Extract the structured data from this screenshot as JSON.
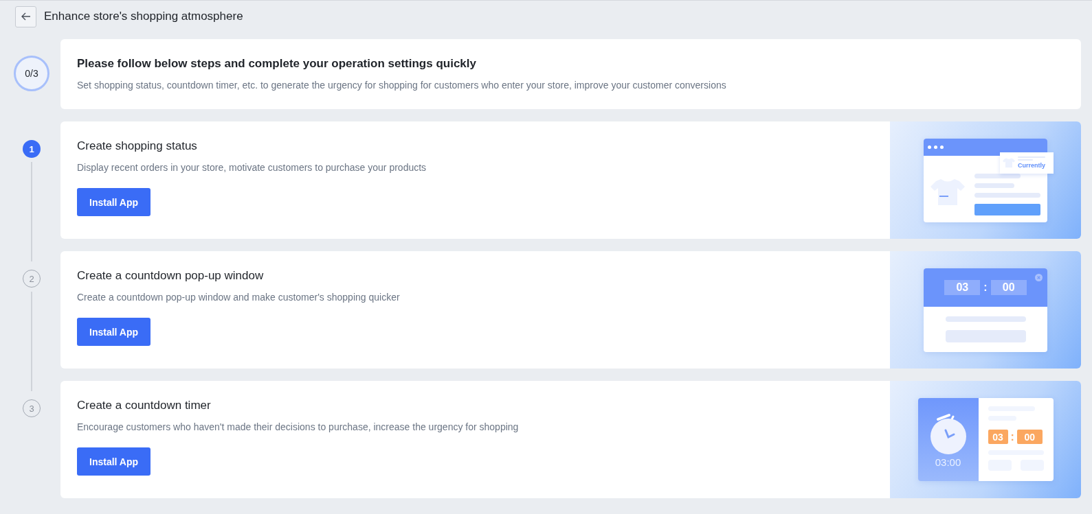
{
  "header": {
    "title": "Enhance store's shopping atmosphere"
  },
  "progress": {
    "label": "0/3"
  },
  "intro": {
    "title": "Please follow below steps and complete your operation settings quickly",
    "description": "Set shopping status, countdown timer, etc. to generate the urgency for shopping for customers who enter your store, improve your customer conversions"
  },
  "steps": [
    {
      "number": "1",
      "selected": true,
      "title": "Create shopping status",
      "description": "Display recent orders in your store, motivate customers to purchase your products",
      "button": "Install App",
      "illustration": {
        "kind": "status",
        "label": "Currently"
      }
    },
    {
      "number": "2",
      "selected": false,
      "title": "Create a countdown pop-up window",
      "description": "Create a countdown pop-up window and make customer's shopping quicker",
      "button": "Install App",
      "illustration": {
        "kind": "popup",
        "minutes": "03",
        "separator": ":",
        "seconds": "00"
      }
    },
    {
      "number": "3",
      "selected": false,
      "title": "Create a countdown timer",
      "description": "Encourage customers who haven't made their decisions to purchase, increase the urgency for shopping",
      "button": "Install App",
      "illustration": {
        "kind": "timer",
        "clock": "03:00",
        "minutes": "03",
        "separator": ":",
        "seconds": "00"
      }
    }
  ]
}
